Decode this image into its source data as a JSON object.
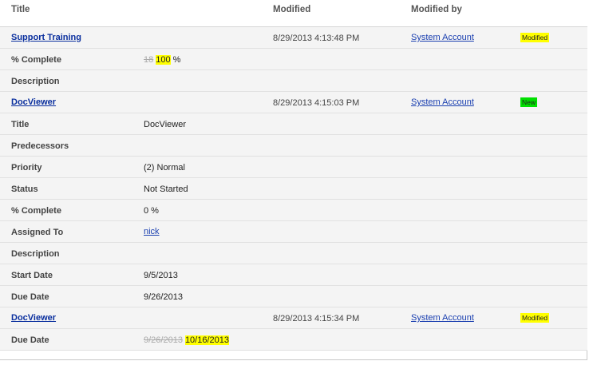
{
  "header": {
    "title": "Title",
    "modified": "Modified",
    "modified_by": "Modified by"
  },
  "items": [
    {
      "title": "Support Training",
      "modified": "8/29/2013 4:13:48 PM",
      "modified_by": "System Account",
      "badge": "Modified",
      "fields": [
        {
          "label": "% Complete",
          "old": "18",
          "new": "100",
          "suffix": " %"
        },
        {
          "label": "Description"
        }
      ]
    },
    {
      "title": "DocViewer",
      "modified": "8/29/2013 4:15:03 PM",
      "modified_by": "System Account",
      "badge": "New",
      "fields": [
        {
          "label": "Title",
          "value": "DocViewer"
        },
        {
          "label": "Predecessors"
        },
        {
          "label": "Priority",
          "value": "(2) Normal"
        },
        {
          "label": "Status",
          "value": "Not Started"
        },
        {
          "label": "% Complete",
          "value": "0 %"
        },
        {
          "label": "Assigned To",
          "value": "nick"
        },
        {
          "label": "Description"
        },
        {
          "label": "Start Date",
          "value": "9/5/2013"
        },
        {
          "label": "Due Date",
          "value": "9/26/2013"
        }
      ]
    },
    {
      "title": "DocViewer",
      "modified": "8/29/2013 4:15:34 PM",
      "modified_by": "System Account",
      "badge": "Modified",
      "fields": [
        {
          "label": "Due Date",
          "old": "9/26/2013",
          "new": "10/16/2013"
        }
      ]
    }
  ],
  "colors": {
    "modified_badge": "#ffff00",
    "new_badge": "#00e000",
    "link": "#0a2f9e"
  }
}
